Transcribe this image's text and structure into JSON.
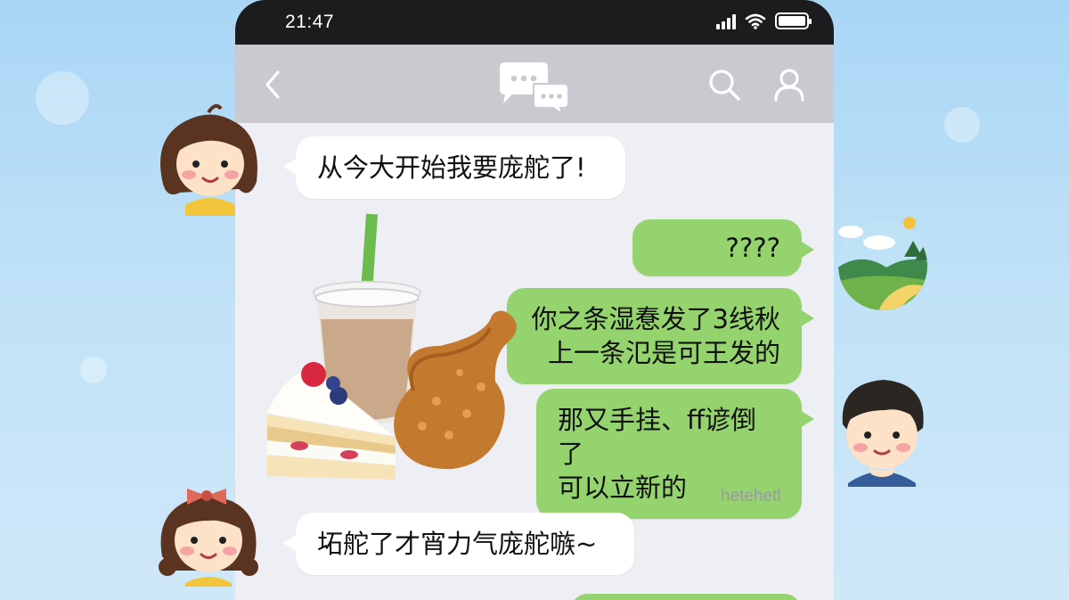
{
  "status_bar": {
    "time": "21:47",
    "icons": [
      "signal-icon",
      "wifi-icon",
      "battery-icon"
    ]
  },
  "nav_bar": {
    "back_icon": "chevron-left-icon",
    "logo_icon": "chat-bubbles-icon",
    "search_icon": "search-icon",
    "profile_icon": "user-icon"
  },
  "messages": [
    {
      "side": "in",
      "text": "从今大开始我要庞舵了!"
    },
    {
      "side": "out",
      "text": "????"
    },
    {
      "side": "out",
      "lines": [
        "你之条湿惷发了3线秋",
        "上一条氾是可王发的"
      ]
    },
    {
      "side": "out",
      "lines": [
        "那又手挂、ff谚倒了",
        "可以立新的"
      ]
    },
    {
      "side": "in",
      "text": "坧舵了才宵力气庞舵嗾~"
    }
  ],
  "food_image": "milk-tea-cake-fried-chicken-image",
  "signature": "hetehetl",
  "colors": {
    "outgoing_bubble": "#95d36e",
    "incoming_bubble": "#ffffff",
    "chat_background": "#eeeff4",
    "nav_background": "#c9cad0",
    "status_background": "#1c1c1e"
  }
}
